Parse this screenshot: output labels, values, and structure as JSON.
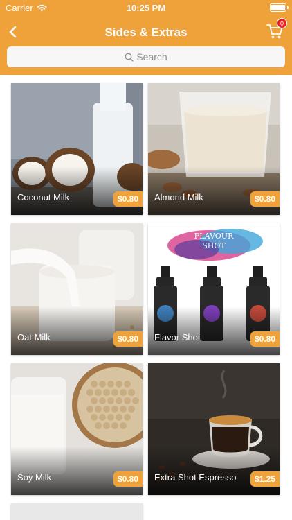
{
  "status_bar": {
    "carrier": "Carrier",
    "time": "10:25 PM"
  },
  "nav": {
    "title": "Sides & Extras",
    "cart_count": "0"
  },
  "search": {
    "placeholder": "Search"
  },
  "items": [
    {
      "name": "Coconut Milk",
      "price": "$0.80"
    },
    {
      "name": "Almond Milk",
      "price": "$0.80"
    },
    {
      "name": "Oat Milk",
      "price": "$0.80"
    },
    {
      "name": "Flavor Shot",
      "price": "$0.80"
    },
    {
      "name": "Soy Milk",
      "price": "$0.80"
    },
    {
      "name": "Extra Shot Espresso",
      "price": "$1.25"
    }
  ],
  "flavour_shot_art": {
    "headline_1": "FLAVOUR",
    "headline_2": "SHOT"
  },
  "colors": {
    "accent": "#F0A23A",
    "badge": "#E42020"
  }
}
